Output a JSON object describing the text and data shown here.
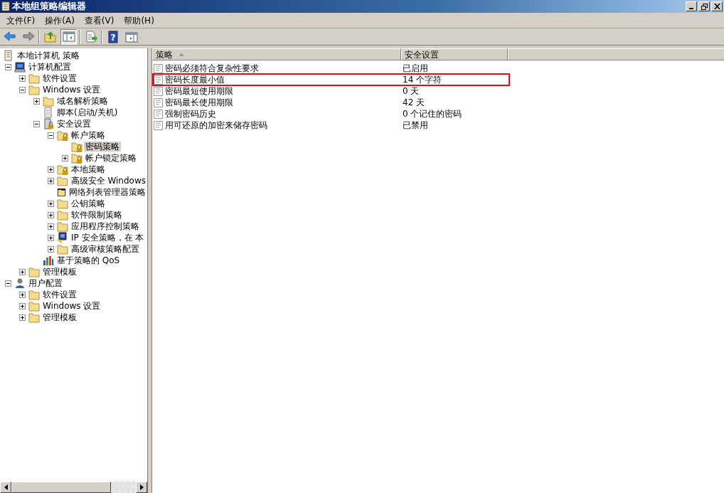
{
  "window": {
    "title": "本地组策略编辑器"
  },
  "menu": [
    "文件(F)",
    "操作(A)",
    "查看(V)",
    "帮助(H)"
  ],
  "toolbar": [
    {
      "kind": "back",
      "pressed": false
    },
    {
      "kind": "forward",
      "pressed": false
    },
    {
      "kind": "sep"
    },
    {
      "kind": "up",
      "pressed": false
    },
    {
      "kind": "tree",
      "pressed": true
    },
    {
      "kind": "sep"
    },
    {
      "kind": "export",
      "pressed": false
    },
    {
      "kind": "sep"
    },
    {
      "kind": "help",
      "pressed": false,
      "glyph": "?"
    },
    {
      "kind": "pane",
      "pressed": false
    }
  ],
  "tree": [
    {
      "label": "本地计算机 策略",
      "kind": "doc",
      "selected": false,
      "children": [
        {
          "label": "计算机配置",
          "kind": "computer",
          "expanded": true,
          "selected": false,
          "children": [
            {
              "label": "软件设置",
              "kind": "folder",
              "expanded": false,
              "selected": false
            },
            {
              "label": "Windows 设置",
              "kind": "folder",
              "expanded": true,
              "selected": false,
              "children": [
                {
                  "label": "域名解析策略",
                  "kind": "folder",
                  "expanded": false,
                  "selected": false
                },
                {
                  "label": "脚本(启动/关机)",
                  "kind": "script",
                  "selected": false
                },
                {
                  "label": "安全设置",
                  "kind": "security",
                  "expanded": true,
                  "selected": false,
                  "children": [
                    {
                      "label": "帐户策略",
                      "kind": "lockfolder",
                      "expanded": true,
                      "selected": false,
                      "children": [
                        {
                          "label": "密码策略",
                          "kind": "lockfolder",
                          "selected": true
                        },
                        {
                          "label": "帐户锁定策略",
                          "kind": "lockfolder",
                          "expanded": false,
                          "selected": false
                        }
                      ]
                    },
                    {
                      "label": "本地策略",
                      "kind": "lockfolder",
                      "expanded": false,
                      "selected": false
                    },
                    {
                      "label": "高级安全 Windows",
                      "kind": "folder",
                      "expanded": false,
                      "selected": false
                    },
                    {
                      "label": "网络列表管理器策略",
                      "kind": "netfolder",
                      "selected": false
                    },
                    {
                      "label": "公钥策略",
                      "kind": "folder",
                      "expanded": false,
                      "selected": false
                    },
                    {
                      "label": "软件限制策略",
                      "kind": "folder",
                      "expanded": false,
                      "selected": false
                    },
                    {
                      "label": "应用程序控制策略",
                      "kind": "folder",
                      "expanded": false,
                      "selected": false
                    },
                    {
                      "label": "IP 安全策略，在 本",
                      "kind": "ip",
                      "expanded": false,
                      "selected": false
                    },
                    {
                      "label": "高级审核策略配置",
                      "kind": "folder",
                      "expanded": false,
                      "selected": false
                    }
                  ]
                },
                {
                  "label": "基于策略的 QoS",
                  "kind": "qos",
                  "selected": false
                }
              ]
            },
            {
              "label": "管理模板",
              "kind": "folder",
              "expanded": false,
              "selected": false
            }
          ]
        },
        {
          "label": "用户配置",
          "kind": "user",
          "expanded": true,
          "selected": false,
          "children": [
            {
              "label": "软件设置",
              "kind": "folder",
              "expanded": false,
              "selected": false
            },
            {
              "label": "Windows 设置",
              "kind": "folder",
              "expanded": false,
              "selected": false
            },
            {
              "label": "管理模板",
              "kind": "folder",
              "expanded": false,
              "selected": false
            }
          ]
        }
      ]
    }
  ],
  "table": {
    "columns": [
      {
        "label": "策略",
        "sorted": true
      },
      {
        "label": "安全设置",
        "sorted": false
      }
    ],
    "rows": [
      {
        "policy": "密码必须符合复杂性要求",
        "setting": "已启用",
        "focused": false,
        "highlighted": false
      },
      {
        "policy": "密码长度最小值",
        "setting": "14 个字符",
        "focused": true,
        "highlighted": true
      },
      {
        "policy": "密码最短使用期限",
        "setting": "0 天",
        "focused": false,
        "highlighted": false
      },
      {
        "policy": "密码最长使用期限",
        "setting": "42 天",
        "focused": false,
        "highlighted": false
      },
      {
        "policy": "强制密码历史",
        "setting": "0 个记住的密码",
        "focused": false,
        "highlighted": false
      },
      {
        "policy": "用可还原的加密来储存密码",
        "setting": "已禁用",
        "focused": false,
        "highlighted": false
      }
    ]
  }
}
